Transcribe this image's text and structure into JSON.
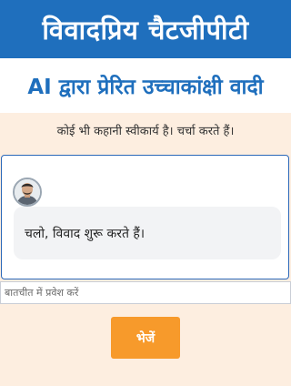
{
  "header": {
    "title": "विवादप्रिय चैटजीपीटी"
  },
  "subheader": {
    "title": "AI द्वारा प्रेरित उच्चाकांक्षी वादी"
  },
  "tagline": "कोई भी कहानी स्वीकार्य है। चर्चा करते हैं।",
  "chat": {
    "messages": [
      {
        "avatar_icon": "person-avatar-icon",
        "text": "चलो, विवाद शुरू करते हैं।"
      }
    ]
  },
  "input": {
    "placeholder": "बातचीत में प्रवेश करें",
    "value": ""
  },
  "send_button": {
    "label": "भेजें"
  },
  "colors": {
    "header_bg": "#1f6fbd",
    "page_bg": "#fdeee0",
    "accent_button": "#f79a2b",
    "chat_border": "#2a67b8"
  }
}
